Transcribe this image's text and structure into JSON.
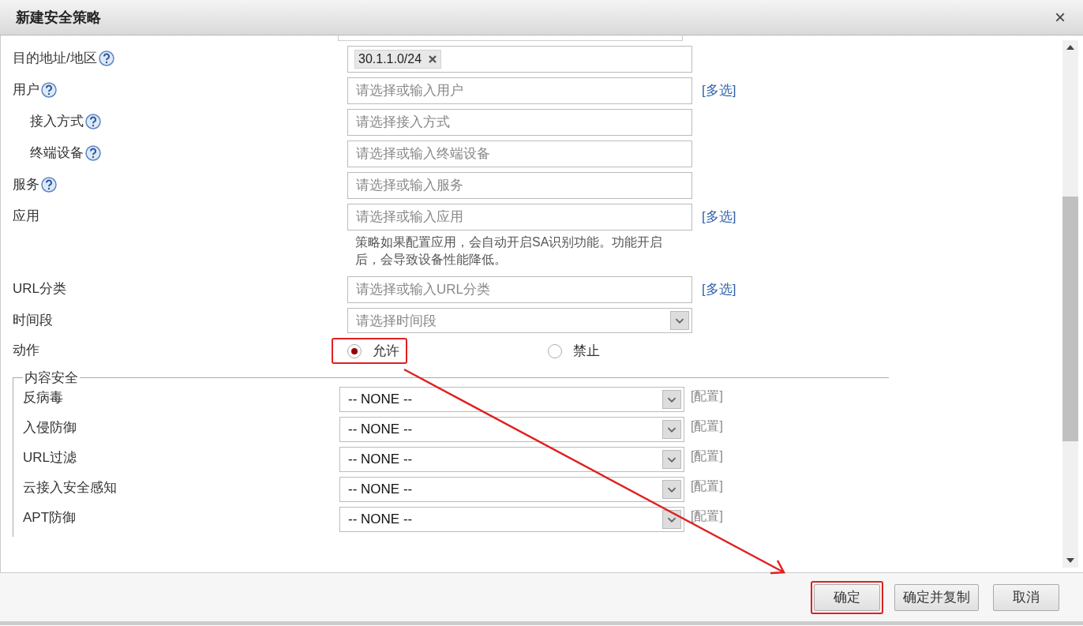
{
  "window": {
    "title": "新建安全策略",
    "close": "×"
  },
  "rows": [
    {
      "kind": "tags",
      "label": "目的地址/地区",
      "help": true,
      "tags": [
        "30.1.1.0/24"
      ]
    },
    {
      "kind": "input",
      "label": "用户",
      "help": true,
      "placeholder": "请选择或输入用户",
      "link": "[多选]",
      "children": [
        {
          "kind": "input",
          "label": "接入方式",
          "help": true,
          "placeholder": "请选择接入方式"
        },
        {
          "kind": "input",
          "label": "终端设备",
          "help": true,
          "placeholder": "请选择或输入终端设备"
        }
      ]
    },
    {
      "kind": "input",
      "label": "服务",
      "help": true,
      "placeholder": "请选择或输入服务"
    },
    {
      "kind": "input",
      "label": "应用",
      "help": false,
      "placeholder": "请选择或输入应用",
      "link": "[多选]",
      "note": "策略如果配置应用，会自动开启SA识别功能。功能开启后，会导致设备性能降低。"
    },
    {
      "kind": "input",
      "label": "URL分类",
      "help": false,
      "placeholder": "请选择或输入URL分类",
      "link": "[多选]"
    },
    {
      "kind": "select",
      "label": "时间段",
      "help": false,
      "placeholder": "请选择时间段"
    },
    {
      "kind": "radio",
      "label": "动作",
      "help": false,
      "options": [
        {
          "label": "允许",
          "selected": true,
          "highlighted": true
        },
        {
          "label": "禁止",
          "selected": false,
          "highlighted": false
        }
      ]
    }
  ],
  "content_security": {
    "legend": "内容安全",
    "rows": [
      {
        "label": "反病毒",
        "value": "-- NONE --",
        "link": "[配置]"
      },
      {
        "label": "入侵防御",
        "value": "-- NONE --",
        "link": "[配置]"
      },
      {
        "label": "URL过滤",
        "value": "-- NONE --",
        "link": "[配置]"
      },
      {
        "label": "云接入安全感知",
        "value": "-- NONE --",
        "link": "[配置]"
      },
      {
        "label": "APT防御",
        "value": "-- NONE --",
        "link": "[配置]"
      }
    ]
  },
  "buttons": [
    {
      "label": "确定",
      "highlighted": true
    },
    {
      "label": "确定并复制",
      "highlighted": false
    },
    {
      "label": "取消",
      "highlighted": false
    }
  ]
}
